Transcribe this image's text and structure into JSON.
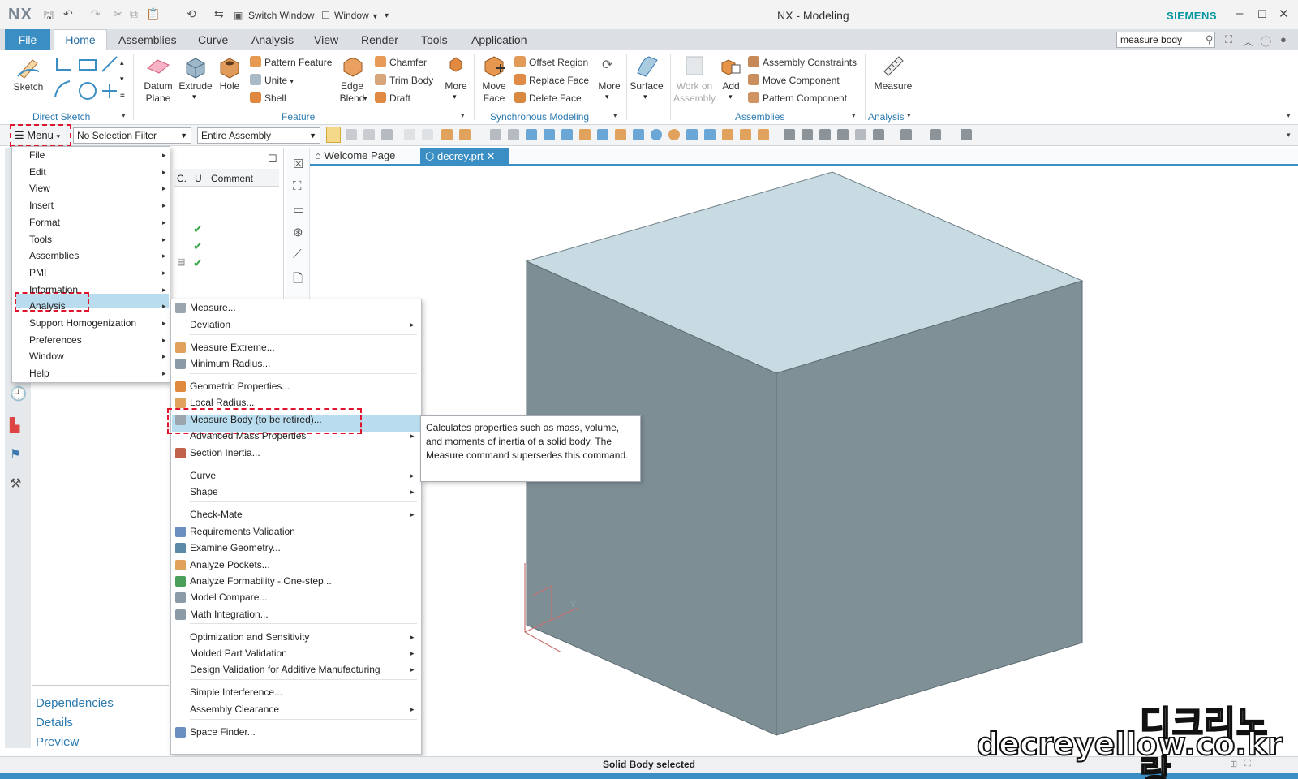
{
  "app": {
    "logo": "NX",
    "window_title": "NX - Modeling",
    "brand": "SIEMENS"
  },
  "quick_access": {
    "switch_window": "Switch Window",
    "window": "Window"
  },
  "tabs": [
    "File",
    "Home",
    "Assemblies",
    "Curve",
    "Analysis",
    "View",
    "Render",
    "Tools",
    "Application"
  ],
  "command_search": {
    "value": "measure body"
  },
  "ribbon": {
    "sketch": "Sketch",
    "datum_plane": "Datum Plane",
    "extrude": "Extrude",
    "hole": "Hole",
    "pattern_feature": "Pattern Feature",
    "unite": "Unite",
    "shell": "Shell",
    "edge_blend": "Edge Blend",
    "chamfer": "Chamfer",
    "trim_body": "Trim Body",
    "draft": "Draft",
    "more1": "More",
    "move_face": "Move Face",
    "offset_region": "Offset Region",
    "replace_face": "Replace Face",
    "delete_face": "Delete Face",
    "more2": "More",
    "surface": "Surface",
    "work_on_assembly": "Work on Assembly",
    "add": "Add",
    "assembly_constraints": "Assembly Constraints",
    "move_component": "Move Component",
    "pattern_component": "Pattern Component",
    "measure": "Measure",
    "groups": {
      "direct_sketch": "Direct Sketch",
      "feature": "Feature",
      "synchronous_modeling": "Synchronous Modeling",
      "assemblies": "Assemblies",
      "analysis": "Analysis"
    }
  },
  "selection_bar": {
    "menu": "Menu",
    "filter": "No Selection Filter",
    "scope": "Entire Assembly"
  },
  "navigator": {
    "col_c": "C.",
    "col_u": "U",
    "col_comment": "Comment",
    "panels": [
      "Dependencies",
      "Details",
      "Preview"
    ]
  },
  "viewport_tabs": {
    "welcome": "Welcome Page",
    "part": "decrey.prt"
  },
  "main_menu": [
    "File",
    "Edit",
    "View",
    "Insert",
    "Format",
    "Tools",
    "Assemblies",
    "PMI",
    "Information",
    "Analysis",
    "Support Homogenization",
    "Preferences",
    "Window",
    "Help"
  ],
  "analysis_menu": [
    "Measure...",
    "Deviation",
    "Measure Extreme...",
    "Minimum Radius...",
    "Geometric Properties...",
    "Local Radius...",
    "Measure Body (to be retired)...",
    "Advanced Mass Properties",
    "Section Inertia...",
    "Curve",
    "Shape",
    "Check-Mate",
    "Requirements Validation",
    "Examine Geometry...",
    "Analyze Pockets...",
    "Analyze Formability - One-step...",
    "Model Compare...",
    "Math Integration...",
    "Optimization and Sensitivity",
    "Molded Part Validation",
    "Design Validation for Additive Manufacturing",
    "Simple Interference...",
    "Assembly Clearance",
    "Space Finder..."
  ],
  "tooltip": "Calculates properties such as mass, volume, and moments of inertia of a solid body. The Measure command supersedes this command.",
  "status": "Solid Body selected",
  "watermark": {
    "line1": "디크리노랑",
    "line2": "decreyellow.co.kr"
  },
  "colors": {
    "accent": "#3a8ec4",
    "highlight": "#b9dcef",
    "red_box": "#e0142c",
    "cube_top": "#c8dae2",
    "cube_left": "#7d8e95",
    "cube_right": "#7f9097"
  }
}
